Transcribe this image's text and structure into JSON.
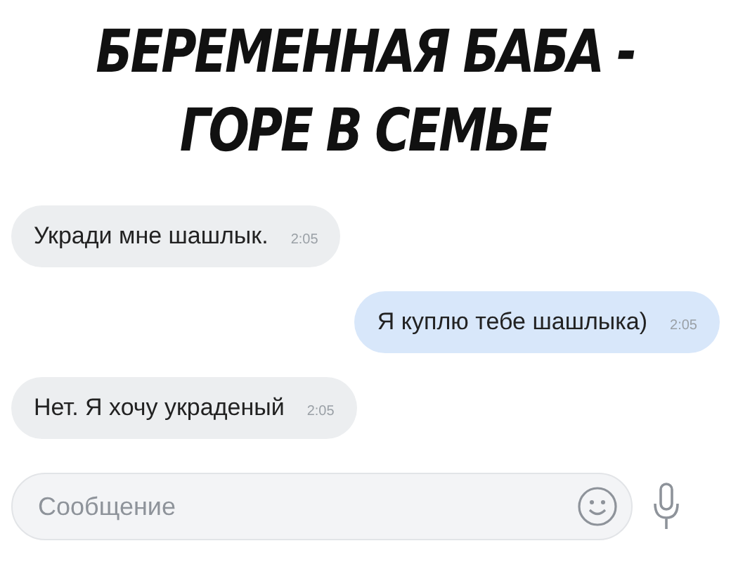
{
  "caption": {
    "lines": [
      "БЕРЕМЕННАЯ БАБА -",
      "ГОРЕ В СЕМЬЕ"
    ]
  },
  "messages": [
    {
      "kind": "incoming",
      "text": "Укради мне шашлык.",
      "time": "2:05"
    },
    {
      "kind": "outgoing",
      "text": "Я куплю тебе шашлыка)",
      "time": "2:05"
    },
    {
      "kind": "incoming",
      "text": "Нет. Я хочу украденый",
      "time": "2:05"
    }
  ],
  "composer": {
    "placeholder": "Сообщение"
  }
}
